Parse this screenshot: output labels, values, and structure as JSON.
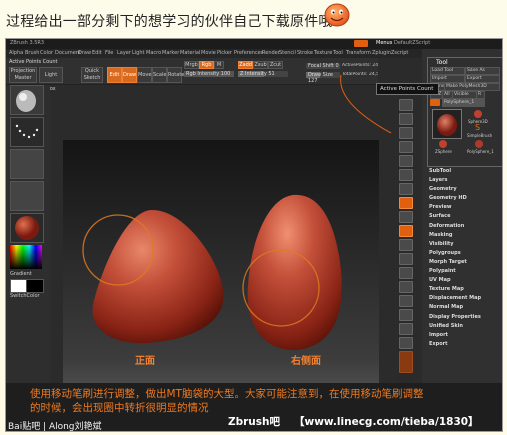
{
  "post": {
    "title": "过程给出一部分剩下的想学习的伙伴自己下载原件哦"
  },
  "app": {
    "window_title": "ZBrush 3.5R3",
    "menu": [
      "Alpha",
      "Brush",
      "Color",
      "Document",
      "Draw",
      "Edit",
      "File",
      "Layer",
      "Light",
      "Macro",
      "Marker",
      "Material",
      "Movie",
      "Picker",
      "Preferences",
      "Render",
      "Stencil",
      "Stroke",
      "Texture",
      "Tool",
      "Transform",
      "Zplugin",
      "Zscript"
    ],
    "menu_right": [
      "Menus",
      "DefaultZScript"
    ],
    "active_points_label": "Active Points Count",
    "toolbar": {
      "projection_master": "Projection Master",
      "lightbox": "Light Box",
      "quick_sketch": "Quick Sketch",
      "edit": "Edit",
      "draw": "Draw",
      "move": "Move",
      "scale": "Scale",
      "rotate": "Rotate",
      "mrgb": "Mrgb",
      "rgb": "Rgb",
      "m": "M",
      "zadd": "Zadd",
      "zsub": "Zsub",
      "zcut": "Zcut",
      "rgb_intensity": "Rgb Intensity 100",
      "z_intensity": "Z Intensity 51",
      "focal_shift": "Focal Shift 0",
      "draw_size": "Draw Size 127",
      "active_points": "ActivePoints: 24,578",
      "total_points": "TotalPoints: 24,578"
    },
    "left_shelf": {
      "gradient": "Gradient",
      "switch_color": "SwitchColor"
    },
    "tooltip": "Active Points Count",
    "tool_panel": {
      "title": "Tool",
      "buttons": [
        "Load Tool",
        "Save As",
        "Import",
        "Export",
        "Clone",
        "Make PolyMesh3D",
        "GoZ",
        "All",
        "Visible",
        "R"
      ],
      "current_tool": "PolySphere_1",
      "thumbs": [
        "PolySphere_1",
        "Sphere3D",
        "SimpleBrush",
        "ZSphere",
        "PolySphere_1"
      ],
      "sections": [
        "SubTool",
        "Layers",
        "Geometry",
        "Geometry HD",
        "Preview",
        "Surface",
        "Deformation",
        "Masking",
        "Visibility",
        "Polygroups",
        "Morph Target",
        "Polypaint",
        "UV Map",
        "Texture Map",
        "Displacement Map",
        "Normal Map",
        "Display Properties",
        "Unified Skin",
        "Import",
        "Export"
      ]
    }
  },
  "canvas": {
    "label_front": "正面",
    "label_side": "右侧面"
  },
  "caption": {
    "line1": "使用移动笔刷进行调整，做出MT脑袋的大型。大家可能注意到，在使用移动笔刷调整",
    "line2": "的时候，会出现圈中转折很明显的情况",
    "brand": "Zbrush吧",
    "url": "【www.linecg.com/tieba/1830】"
  },
  "watermark": {
    "text": "Bai贴吧 | Along刘艳斌"
  },
  "colors": {
    "accent": "#e06010",
    "caption_text": "#f07a20",
    "head_red": "#b23a20"
  }
}
